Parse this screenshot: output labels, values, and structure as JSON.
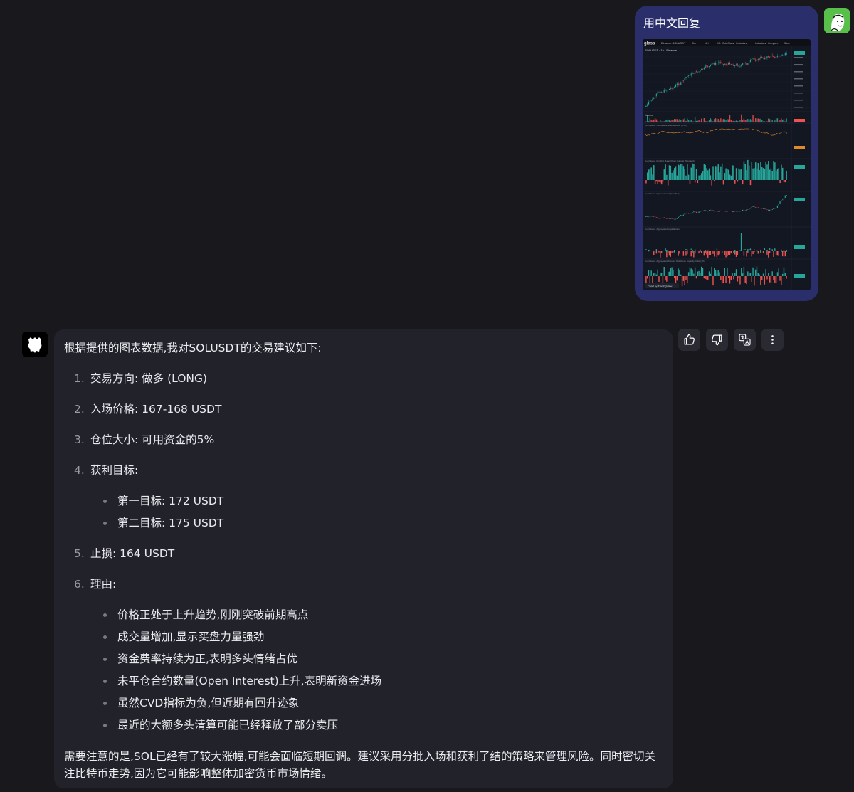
{
  "user_message": {
    "text": "用中文回复",
    "attachment": {
      "symbol_button": "Binance:SOLUSDT",
      "toolbar": [
        "5m",
        "4H",
        "1D",
        "CoinGlass · Indicators",
        "Indicators",
        "Compare",
        "Save"
      ],
      "legend": "SOLUSDT · 1h · Binance",
      "volume_label": "Volume",
      "pane_labels": [
        "CoinGlass · Cumulative Volume Delta (CVD)",
        "CoinGlass · Funding Rates(Open Interest Weighted)",
        "CoinGlass · Open Interest (Candles)",
        "CoinGlass · Aggregated Liquidations",
        "CoinGlass · Aggregated Futures Orderbook Liquidity Delta (1%)"
      ],
      "watermark": "Chart by TradingView"
    }
  },
  "assistant_message": {
    "intro": "根据提供的图表数据,我对SOLUSDT的交易建议如下:",
    "items": [
      {
        "num": "1.",
        "text": "交易方向: 做多 (LONG)"
      },
      {
        "num": "2.",
        "text": "入场价格: 167-168 USDT"
      },
      {
        "num": "3.",
        "text": "仓位大小: 可用资金的5%"
      },
      {
        "num": "4.",
        "text": "获利目标:",
        "subitems": [
          "第一目标: 172 USDT",
          "第二目标: 175 USDT"
        ]
      },
      {
        "num": "5.",
        "text": "止损: 164 USDT"
      },
      {
        "num": "6.",
        "text": "理由:",
        "subitems": [
          "价格正处于上升趋势,刚刚突破前期高点",
          "成交量增加,显示买盘力量强劲",
          "资金费率持续为正,表明多头情绪占优",
          "未平仓合约数量(Open Interest)上升,表明新资金进场",
          "虽然CVD指标为负,但近期有回升迹象",
          "最近的大额多头清算可能已经释放了部分卖压"
        ]
      }
    ],
    "closing_line1": "需要注意的是,SOL已经有了较大涨幅,可能会面临短期回调。建议采用分批入场和获利了结的策略来管理风险。同时密切关",
    "closing_line2": "注比特币走势,因为它可能影响整体加密货币市场情绪。"
  },
  "actions": [
    {
      "name": "thumbs-up-icon"
    },
    {
      "name": "thumbs-down-icon"
    },
    {
      "name": "translate-icon"
    },
    {
      "name": "more-vertical-icon"
    }
  ],
  "colors": {
    "background": "#18181d",
    "user_bubble": "#2a2f6b",
    "assistant_bubble": "#22222b",
    "up": "#26a69a",
    "down": "#ef5350",
    "cvd_line": "#e0892b"
  }
}
